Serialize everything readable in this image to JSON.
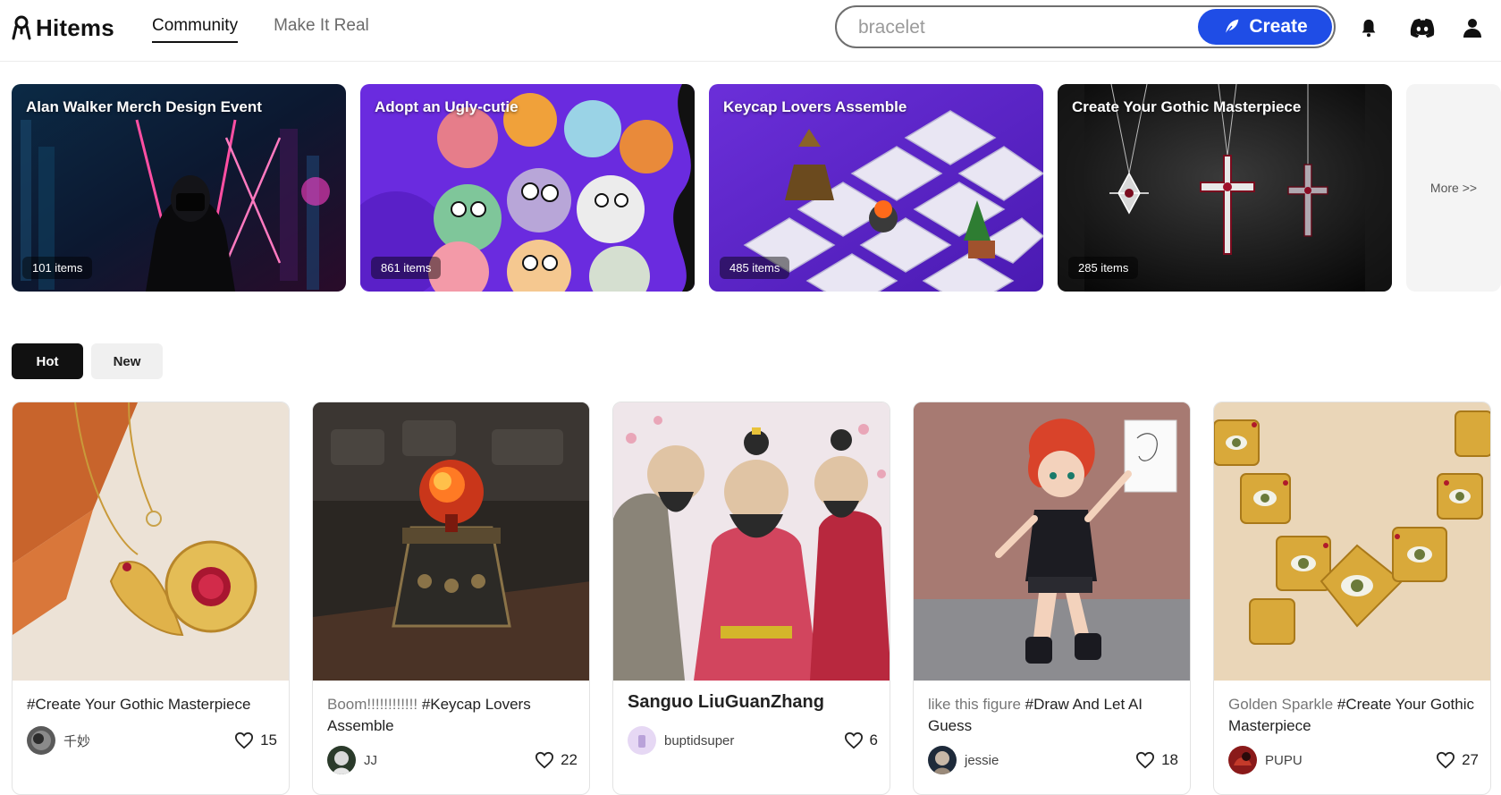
{
  "header": {
    "logo_text": "Hitems",
    "nav": [
      {
        "label": "Community",
        "active": true
      },
      {
        "label": "Make It Real",
        "active": false
      }
    ],
    "search": {
      "value": "bracelet",
      "placeholder": "bracelet"
    },
    "create_label": "Create",
    "icons": [
      "bell-icon",
      "discord-icon",
      "user-icon"
    ]
  },
  "banners": [
    {
      "title": "Alan Walker Merch Design Event",
      "count": "101 items"
    },
    {
      "title": "Adopt an Ugly-cutie",
      "count": "861 items"
    },
    {
      "title": "Keycap Lovers Assemble",
      "count": "485 items"
    },
    {
      "title": "Create Your Gothic Masterpiece",
      "count": "285 items"
    }
  ],
  "more_label": "More >>",
  "filters": {
    "hot": "Hot",
    "new": "New"
  },
  "cards": [
    {
      "prefix": "",
      "tag": "#Create Your Gothic Masterpiece",
      "user": "千妙",
      "likes": "15"
    },
    {
      "prefix": "Boom!!!!!!!!!!!! ",
      "tag": "#Keycap Lovers Assemble",
      "user": "JJ",
      "likes": "22"
    },
    {
      "title": "Sanguo LiuGuanZhang",
      "user": "buptidsuper",
      "likes": "6"
    },
    {
      "prefix": "like this figure ",
      "tag": "#Draw And Let AI Guess",
      "user": "jessie",
      "likes": "18"
    },
    {
      "prefix": "Golden Sparkle ",
      "tag": "#Create Your Gothic Masterpiece",
      "user": "PUPU",
      "likes": "27"
    }
  ],
  "colors": {
    "accent": "#1f4de6",
    "hot_bg": "#111111"
  }
}
